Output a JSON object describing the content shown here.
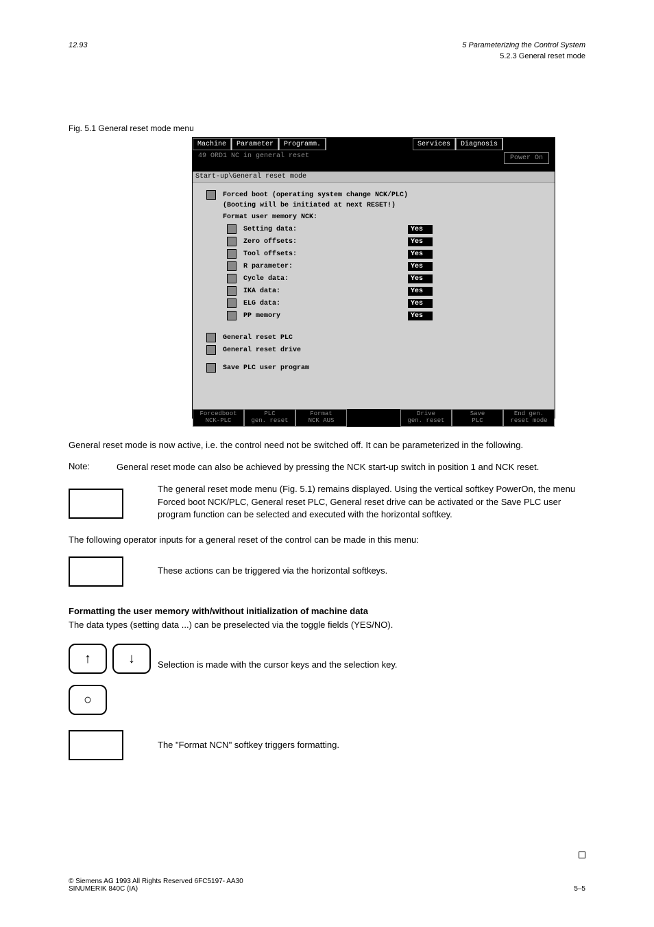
{
  "page": {
    "header_left": "12.93",
    "header_right": "5 Parameterizing the Control System",
    "title": "5.2.3 General reset mode",
    "figure_caption": "Fig. 5.1 General reset mode menu",
    "footer_left": "© Siemens AG 1993 All Rights Reserved    6FC5197-  AA30\nSINUMERIK 840C (IA)",
    "footer_right": "5–5"
  },
  "cnc": {
    "tabs": {
      "machine": "Machine",
      "parameter": "Parameter",
      "programm": "Programm.",
      "services": "Services",
      "diagnosis": "Diagnosis"
    },
    "status_line": "49 ORD1 NC in general reset",
    "power_on": "Power On",
    "breadcrumb": "Start-up\\General reset mode",
    "forced_boot_line1": "Forced boot (operating system change NCK/PLC)",
    "forced_boot_line2": "(Booting will be initiated at next RESET!)",
    "format_header": "Format user memory NCK:",
    "items": {
      "setting_data": "Setting data:",
      "zero_offsets": "Zero offsets:",
      "tool_offsets": "Tool offsets:",
      "r_parameter": "R parameter:",
      "cycle_data": "Cycle data:",
      "ika_data": "IKA data:",
      "elg_data": "ELG data:",
      "pp_memory": "PP memory"
    },
    "yes": "Yes",
    "general_reset_plc": "General reset PLC",
    "general_reset_drive": "General reset drive",
    "save_plc": "Save PLC user program",
    "bottom_tabs": {
      "forcedboot": "Forcedboot\nNCK-PLC",
      "plc_gen_reset": "PLC\ngen. reset",
      "format_nck": "Format\nNCK AUS",
      "drive_gen_reset": "Drive\ngen. reset",
      "save_plc": "Save\nPLC",
      "end_gen": "End gen.\nreset mode"
    }
  },
  "doc": {
    "s1": "General reset mode is now active, i.e. the control need not be switched off. It can be parameterized in the following.",
    "s2_note": "Note:",
    "s2": "General reset mode can also be achieved by pressing the NCK start-up switch in position 1 and NCK reset.",
    "s3": "The general reset mode menu (Fig. 5.1) remains displayed. Using the vertical softkey PowerOn, the menu Forced boot NCK/PLC, General reset PLC, General reset drive can be activated or the Save PLC user program function can be selected and executed with the horizontal softkey.",
    "s4": "The following operator inputs for a general reset of the control can be made in this menu:",
    "s5": "These actions can be triggered via the horizontal softkeys.",
    "s6_title": "Formatting the user memory with/without initialization of machine data",
    "s6": "The data types (setting data ...) can be preselected via the toggle fields (YES/NO).",
    "s7": "Selection is made with the cursor keys and the selection key.",
    "s8": "The \"Format NCN\" softkey triggers formatting."
  }
}
